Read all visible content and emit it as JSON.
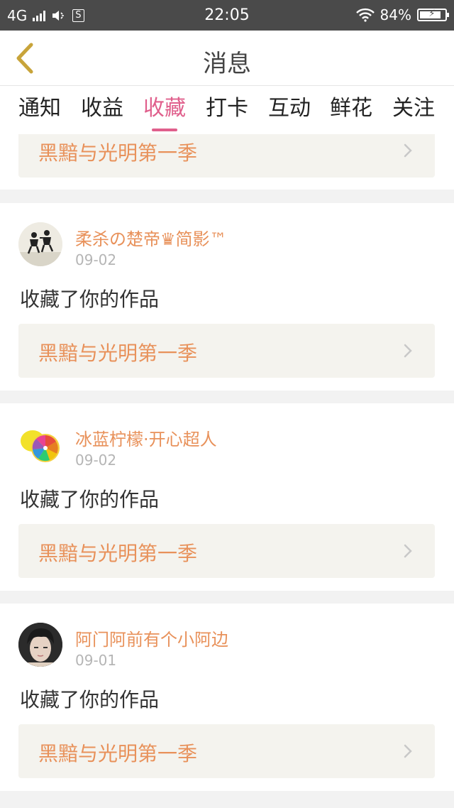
{
  "status_bar": {
    "network": "4G",
    "sim": "S",
    "time": "22:05",
    "battery": "84%",
    "battery_level": 0.84
  },
  "nav": {
    "title": "消息",
    "back_icon": "chevron-left-icon",
    "accent_color": "#c8a43a"
  },
  "tabs": [
    {
      "label": "通知"
    },
    {
      "label": "收益"
    },
    {
      "label": "收藏",
      "active": true
    },
    {
      "label": "打卡"
    },
    {
      "label": "互动"
    },
    {
      "label": "鲜花"
    },
    {
      "label": "关注"
    }
  ],
  "colors": {
    "active_tab": "#e05f8c",
    "username": "#e8915a",
    "work_title": "#e8915a",
    "work_box_bg": "#f4f3ee"
  },
  "partial_card": {
    "work_title": "黑黯与光明第一季"
  },
  "cards": [
    {
      "username": "柔杀の楚帝♛简影™",
      "date": "09-02",
      "action": "收藏了你的作品",
      "work_title": "黑黯与光明第一季",
      "avatar": "couple-jumping-avatar"
    },
    {
      "username": "冰蓝柠檬·开心超人",
      "date": "09-02",
      "action": "收藏了你的作品",
      "work_title": "黑黯与光明第一季",
      "avatar": "lemon-avatar"
    },
    {
      "username": "阿门阿前有个小阿边",
      "date": "09-01",
      "action": "收藏了你的作品",
      "work_title": "黑黯与光明第一季",
      "avatar": "portrait-avatar"
    }
  ]
}
